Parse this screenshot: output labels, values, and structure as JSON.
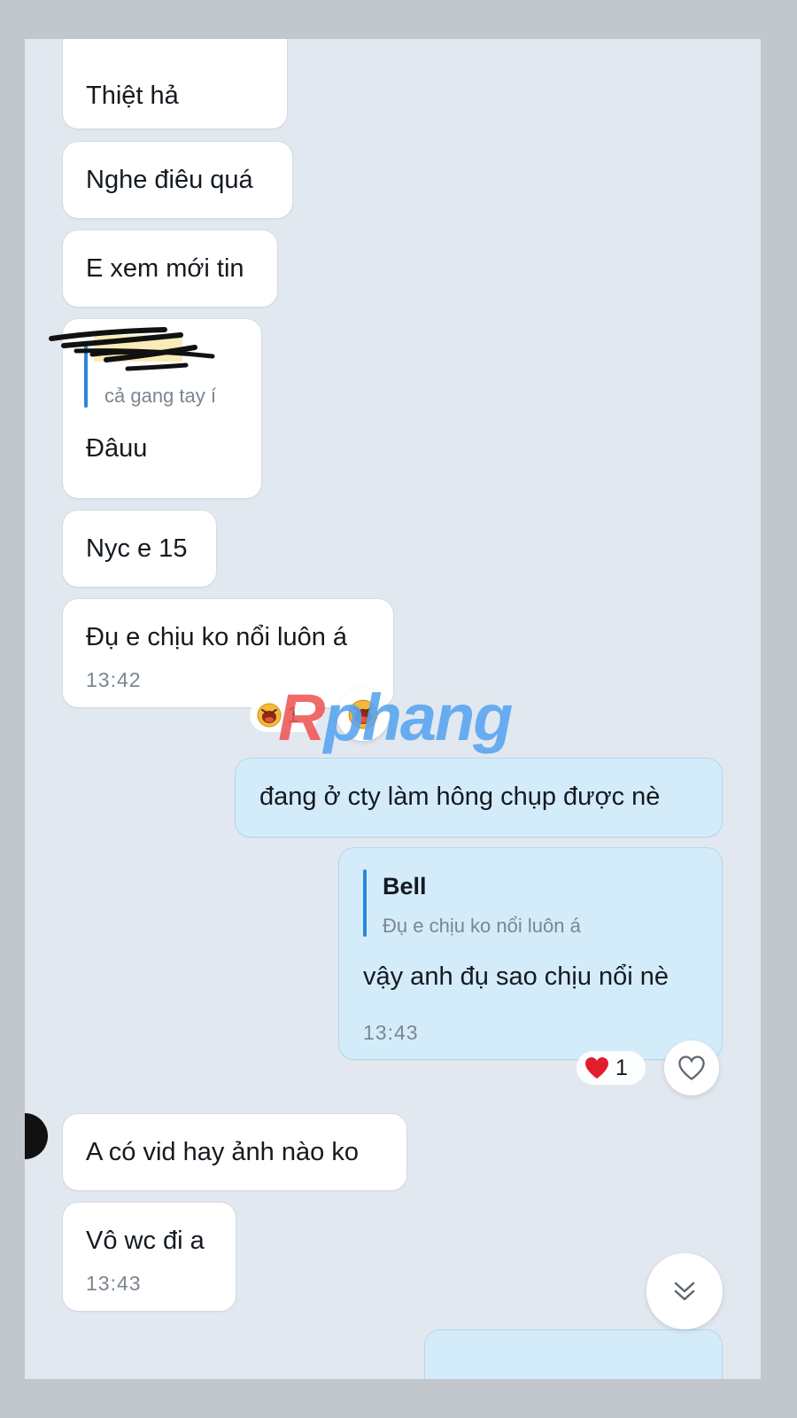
{
  "colors": {
    "screen_bg": "#e2e8f0",
    "incoming_bubble": "#ffffff",
    "outgoing_bubble": "#d4ecfa",
    "quote_bar": "#2b86d9",
    "heart": "#e11d2e"
  },
  "messages": [
    {
      "side": "incoming",
      "text": "Thiệt hả"
    },
    {
      "side": "incoming",
      "text": "Nghe điêu quá"
    },
    {
      "side": "incoming",
      "text": "E xem mới tin"
    },
    {
      "side": "incoming",
      "quote_name_redacted": true,
      "quote_text": "cả gang tay í",
      "text": "Đâuu"
    },
    {
      "side": "incoming",
      "text": "Nyc e 15"
    },
    {
      "side": "incoming",
      "text": "Đụ e chịu ko nổi luôn á",
      "time": "13:42",
      "reaction": {
        "emoji_icon": "laughing-face-icon",
        "count": "1"
      }
    },
    {
      "side": "outgoing",
      "text": "đang ở cty làm hông chụp được nè"
    },
    {
      "side": "outgoing",
      "quote_name": "Bell",
      "quote_text": "Đụ e chịu ko nổi luôn á",
      "text": "vậy anh đụ sao chịu nổi nè",
      "time": "13:43",
      "reaction": {
        "emoji_icon": "heart-icon",
        "count": "1"
      }
    },
    {
      "side": "incoming",
      "text": "A có vid hay ảnh nào ko"
    },
    {
      "side": "incoming",
      "text": "Vô wc đi a",
      "time": "13:43"
    }
  ],
  "watermark": "Rphang"
}
